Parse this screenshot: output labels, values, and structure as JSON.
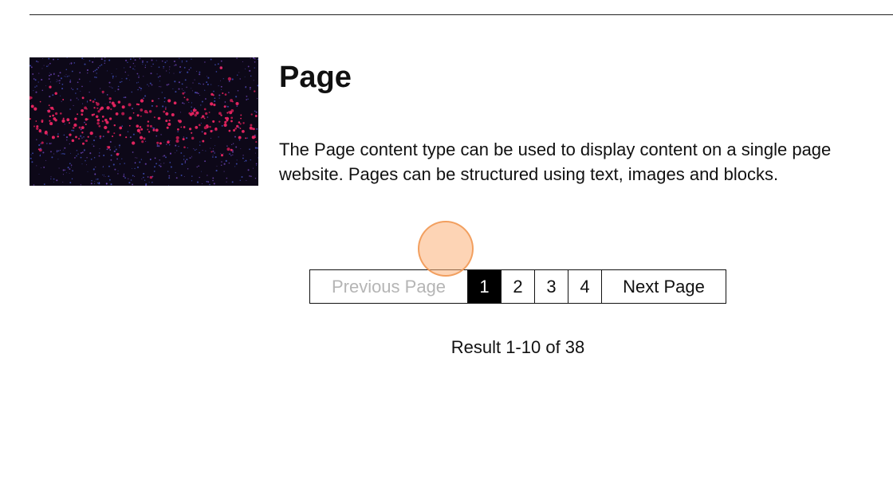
{
  "result": {
    "title": "Page",
    "description_line1": "The Page content type can be used to display content on a single page",
    "description_line2": "website. Pages can be structured using text, images and blocks.",
    "thumbnail": "abstract-particles-image"
  },
  "pagination": {
    "previous_label": "Previous Page",
    "pages": [
      "1",
      "2",
      "3",
      "4"
    ],
    "current_page": "1",
    "next_label": "Next Page"
  },
  "results_summary": "Result 1-10 of 38",
  "colors": {
    "active_page_bg": "#000000",
    "disabled_text": "#b5b5b5",
    "cursor_marker": "#fcb078"
  }
}
